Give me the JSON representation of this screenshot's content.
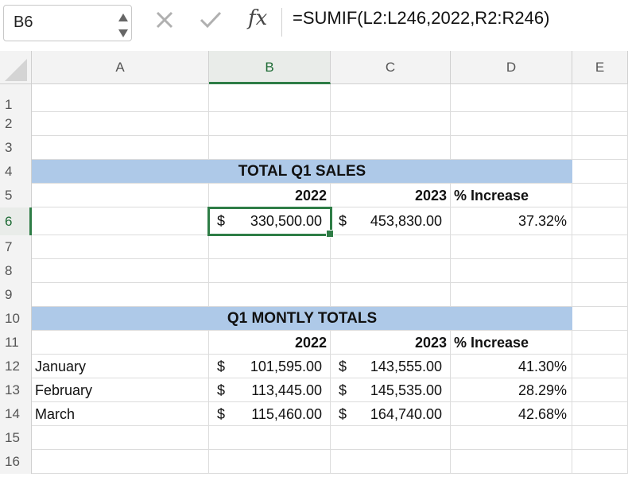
{
  "formula_bar": {
    "name_box": "B6",
    "cancel_icon": "x-icon",
    "confirm_icon": "check-icon",
    "fx": "fx",
    "formula": "=SUMIF(L2:L246,2022,R2:R246)"
  },
  "columns": [
    "A",
    "B",
    "C",
    "D",
    "E"
  ],
  "rows": [
    "1",
    "2",
    "3",
    "4",
    "5",
    "6",
    "7",
    "8",
    "9",
    "10",
    "11",
    "12",
    "13",
    "14",
    "15",
    "16"
  ],
  "selected": {
    "cell": "B6",
    "column": "B",
    "row": "6"
  },
  "colors": {
    "accent": "#2e7d46",
    "banner": "#aec9e8"
  },
  "sheet": {
    "total_title": "TOTAL Q1 SALES",
    "total_header": {
      "y2022": "2022",
      "y2023": "2023",
      "increase": "% Increase"
    },
    "total_row": {
      "v2022": {
        "sym": "$",
        "num": "330,500.00"
      },
      "v2023": {
        "sym": "$",
        "num": "453,830.00"
      },
      "increase": "37.32%"
    },
    "monthly_title": "Q1 MONTLY TOTALS",
    "monthly_header": {
      "y2022": "2022",
      "y2023": "2023",
      "increase": "% Increase"
    },
    "months": [
      {
        "name": "January",
        "v2022": {
          "sym": "$",
          "num": "101,595.00"
        },
        "v2023": {
          "sym": "$",
          "num": "143,555.00"
        },
        "increase": "41.30%"
      },
      {
        "name": "February",
        "v2022": {
          "sym": "$",
          "num": "113,445.00"
        },
        "v2023": {
          "sym": "$",
          "num": "145,535.00"
        },
        "increase": "28.29%"
      },
      {
        "name": "March",
        "v2022": {
          "sym": "$",
          "num": "115,460.00"
        },
        "v2023": {
          "sym": "$",
          "num": "164,740.00"
        },
        "increase": "42.68%"
      }
    ]
  }
}
